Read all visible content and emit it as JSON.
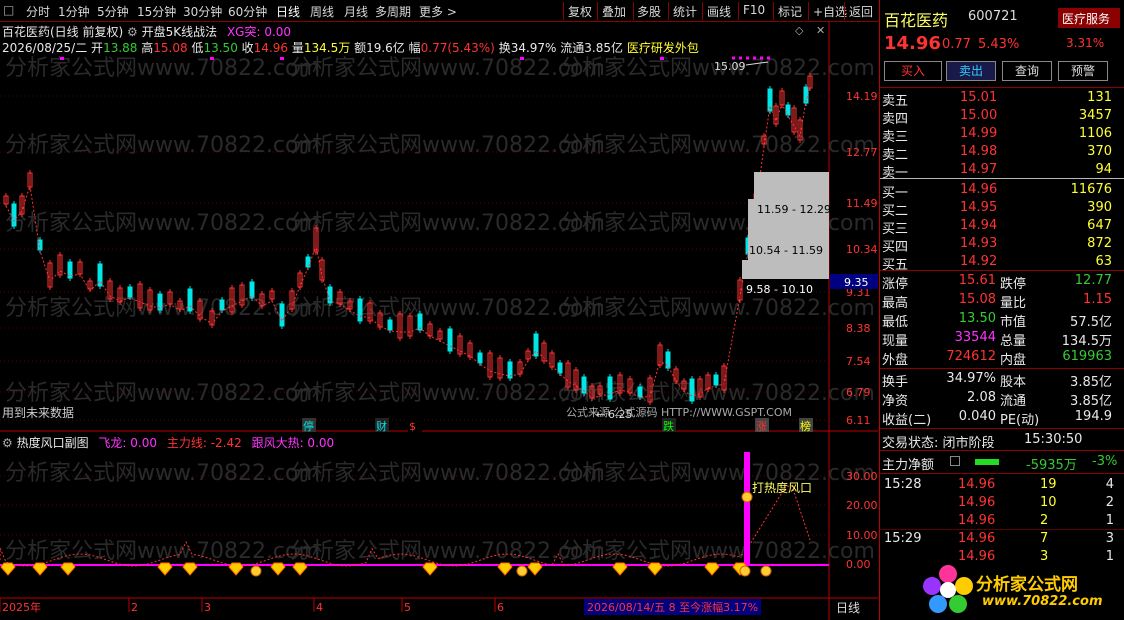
{
  "toolbar": {
    "left": [
      "分时",
      "1分钟",
      "5分钟",
      "15分钟",
      "30分钟",
      "60分钟",
      "日线",
      "周线",
      "月线",
      "多周期",
      "更多 >"
    ],
    "right": [
      "复权",
      "叠加",
      "多股",
      "统计",
      "画线",
      "F10",
      "标记",
      "+自选",
      "返回"
    ]
  },
  "header": {
    "title": "百花医药(日线 前复权)",
    "indicator": "开盘5K线战法",
    "xg": "XG突: 0.00",
    "date": "2026/08/25/二",
    "open_l": "开",
    "open": "13.88",
    "high_l": "高",
    "high": "15.08",
    "low_l": "低",
    "low": "13.50",
    "close_l": "收",
    "close": "14.96",
    "vol_l": "量",
    "vol": "134.5万",
    "amt_l": "额",
    "amt": "19.6亿",
    "chg_l": "幅",
    "chg": "0.77(5.43%)",
    "turn": "换34.97%",
    "float": "流通3.85亿",
    "sector": "医疗研发外包"
  },
  "watermark": "分析家公式网www.70822.com",
  "price_axis": [
    "14.19",
    "12.77",
    "11.49",
    "10.34",
    "9.31",
    "8.38",
    "7.54",
    "6.79",
    "6.11"
  ],
  "price_tag": "9.35",
  "annotations": {
    "high": "15.09",
    "low": "6.25",
    "zone1": "11.59 - 12.29",
    "zone2": "10.54 - 11.59",
    "zone3": "9.58 - 10.10",
    "future": "用到未来数据",
    "formula": "公式来源 公式源码 HTTP://WWW.GSPT.COM"
  },
  "markers": [
    "停",
    "财",
    "$",
    "跌",
    "涨",
    "榜"
  ],
  "sub": {
    "title": "热度风口副图",
    "fl": "飞龙: 0.00",
    "zl": "主力线: -2.42",
    "gf": "跟风大热: 0.00",
    "label": "打热度风口",
    "axis": [
      "30.00",
      "20.00",
      "10.00",
      "0.00"
    ]
  },
  "xaxis": {
    "labels": [
      "2025年",
      "2",
      "3",
      "4",
      "5",
      "6"
    ],
    "info": "2026/08/14/五 8 至今涨幅3.17%",
    "period": "日线"
  },
  "stock": {
    "name": "百花医药",
    "code": "600721",
    "sector": "医疗服务",
    "sector_pct": "3.31%",
    "price": "14.96",
    "chg": "0.77",
    "pct": "5.43%"
  },
  "buttons": [
    "买入",
    "卖出",
    "查询",
    "预警"
  ],
  "asks": [
    {
      "l": "卖五",
      "p": "15.01",
      "v": "131"
    },
    {
      "l": "卖四",
      "p": "15.00",
      "v": "3457"
    },
    {
      "l": "卖三",
      "p": "14.99",
      "v": "1106"
    },
    {
      "l": "卖二",
      "p": "14.98",
      "v": "370"
    },
    {
      "l": "卖一",
      "p": "14.97",
      "v": "94"
    }
  ],
  "bids": [
    {
      "l": "买一",
      "p": "14.96",
      "v": "11676"
    },
    {
      "l": "买二",
      "p": "14.95",
      "v": "390"
    },
    {
      "l": "买三",
      "p": "14.94",
      "v": "647"
    },
    {
      "l": "买四",
      "p": "14.93",
      "v": "872"
    },
    {
      "l": "买五",
      "p": "14.92",
      "v": "63"
    }
  ],
  "stats1": [
    {
      "a": "涨停",
      "av": "15.61",
      "ac": "red",
      "b": "跌停",
      "bv": "12.77",
      "bc": "green"
    },
    {
      "a": "最高",
      "av": "15.08",
      "ac": "red",
      "b": "量比",
      "bv": "1.15",
      "bc": "red"
    },
    {
      "a": "最低",
      "av": "13.50",
      "ac": "green",
      "b": "市值",
      "bv": "57.5亿",
      "bc": "white"
    },
    {
      "a": "现量",
      "av": "33544",
      "ac": "mag",
      "b": "总量",
      "bv": "134.5万",
      "bc": "white"
    },
    {
      "a": "外盘",
      "av": "724612",
      "ac": "red",
      "b": "内盘",
      "bv": "619963",
      "bc": "green"
    }
  ],
  "stats2": [
    {
      "a": "换手",
      "av": "34.97%",
      "b": "股本",
      "bv": "3.85亿"
    },
    {
      "a": "净资",
      "av": "2.08",
      "b": "流通",
      "bv": "3.85亿"
    },
    {
      "a": "收益(二)",
      "av": "0.040",
      "b": "PE(动)",
      "bv": "194.9"
    }
  ],
  "trade_status": "交易状态: 闭市阶段",
  "trade_time": "15:30:50",
  "flow": {
    "label": "主力净额",
    "val": "-5935万",
    "pct": "-3%"
  },
  "ticks": [
    {
      "t": "15:28",
      "p": "14.96",
      "v": "19",
      "n": "4"
    },
    {
      "t": "",
      "p": "14.96",
      "v": "10",
      "n": "2"
    },
    {
      "t": "",
      "p": "14.96",
      "v": "2",
      "n": "1"
    },
    {
      "t": "15:29",
      "p": "14.96",
      "v": "7",
      "n": "3"
    },
    {
      "t": "",
      "p": "14.96",
      "v": "3",
      "n": "1"
    }
  ],
  "logo": {
    "name": "分析家公式网",
    "url": "www.70822.com"
  },
  "colors": {
    "up": "#ff3333",
    "down": "#00e5e5",
    "ma": "#ff3333",
    "accent": "#ff00ff"
  }
}
